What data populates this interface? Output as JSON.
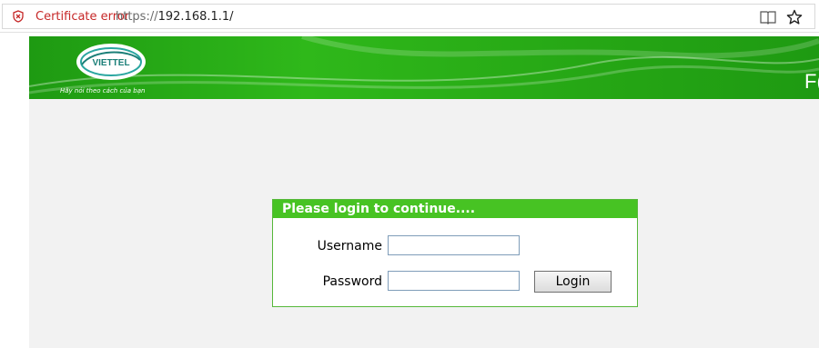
{
  "browser": {
    "cert_error": "Certificate error",
    "url_protocol": "https://",
    "url_host": "192.168.1.1/"
  },
  "banner": {
    "brand": "VIETTEL",
    "tagline": "Hãy nói theo cách của bạn",
    "right_text": "F("
  },
  "login": {
    "header": "Please login to continue....",
    "username_label": "Username",
    "password_label": "Password",
    "username_value": "",
    "password_value": "",
    "button_label": "Login"
  },
  "colors": {
    "banner_green": "#2fb81a",
    "header_green": "#47c323",
    "cert_error_red": "#c62828",
    "page_bg": "#f2f2f2"
  },
  "icons": {
    "cert": "shield-x-icon",
    "reading_view": "reading-view-icon",
    "favorite": "star-icon"
  }
}
